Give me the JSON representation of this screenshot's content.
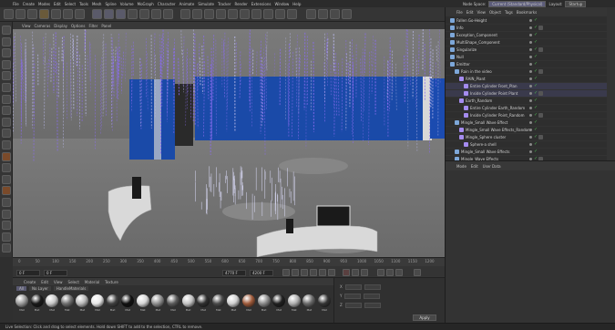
{
  "menubar": {
    "items": [
      "File",
      "Create",
      "Modes",
      "Edit",
      "Select",
      "Tools",
      "Mesh",
      "Spline",
      "Volume",
      "MoGraph",
      "Character",
      "Animate",
      "Simulate",
      "Tracker",
      "Render",
      "Extensions",
      "Window",
      "Help"
    ]
  },
  "topright": {
    "node_space_label": "Node Space:",
    "node_space_value": "Current (Standard/Physical)",
    "layout_label": "Layout:",
    "layout_value": "Startup"
  },
  "viewport_menu": [
    "View",
    "Cameras",
    "Display",
    "Options",
    "Filter",
    "Panel"
  ],
  "object_manager": {
    "menu": [
      "File",
      "Edit",
      "View",
      "Object",
      "Tags",
      "Bookmarks"
    ],
    "objects": [
      {
        "name": "Fallen Go-Height",
        "indent": 0
      },
      {
        "name": "Info",
        "indent": 0
      },
      {
        "name": "Exception_Component",
        "indent": 0
      },
      {
        "name": "MultiShape_Component",
        "indent": 0
      },
      {
        "name": "Singularize",
        "indent": 0
      },
      {
        "name": "Null",
        "indent": 0
      },
      {
        "name": "Emitter",
        "indent": 0
      },
      {
        "name": "Rain in the video",
        "indent": 1
      },
      {
        "name": "RAIN_Plant",
        "indent": 2
      },
      {
        "name": "Entire Cylinder Front_Plan",
        "indent": 3
      },
      {
        "name": "Inside Cylinder Point Plant",
        "indent": 3
      },
      {
        "name": "Earth_Random",
        "indent": 2
      },
      {
        "name": "Entire Cylinder Earth_Random",
        "indent": 3
      },
      {
        "name": "Inside Cylinder Point_Random",
        "indent": 3
      },
      {
        "name": "Mingle_Small Wave Effect",
        "indent": 1
      },
      {
        "name": "Mingle_Small Wave Effects_Random",
        "indent": 2
      },
      {
        "name": "Mingle_Sphere cluster",
        "indent": 2
      },
      {
        "name": "Sphere-a shell",
        "indent": 3
      },
      {
        "name": "Mingle_Small Wave Effects",
        "indent": 1
      },
      {
        "name": "Mingle_Wave Effects",
        "indent": 1
      }
    ]
  },
  "attribute_manager": {
    "menu": [
      "Mode",
      "Edit",
      "User Data"
    ]
  },
  "timeline": {
    "ticks": [
      "0",
      "50",
      "100",
      "150",
      "200",
      "250",
      "300",
      "350",
      "400",
      "450",
      "500",
      "550",
      "600",
      "650",
      "700",
      "750",
      "800",
      "850",
      "900",
      "950",
      "1000",
      "1050",
      "1100",
      "1150",
      "1200"
    ],
    "current_frame": "0 F",
    "start_frame": "0 F",
    "end_frame": "4770 F",
    "max_frame": "4200 F"
  },
  "material_panel": {
    "tabs": [
      "Create",
      "Edit",
      "View",
      "Select",
      "Material",
      "Texture"
    ],
    "filters": [
      "All",
      "No Layer",
      "HandleMaterials"
    ],
    "materials": [
      {
        "label": "Mat",
        "color": "#9a9a9a"
      },
      {
        "label": "Mat",
        "color": "#1a1a1a"
      },
      {
        "label": "Mat",
        "color": "#c8c8c8"
      },
      {
        "label": "Mat",
        "color": "#707070"
      },
      {
        "label": "Mat",
        "color": "#b8b8b8"
      },
      {
        "label": "Mat",
        "color": "#e8e8e8"
      },
      {
        "label": "Mat",
        "color": "#404040"
      },
      {
        "label": "Mat",
        "color": "#111111"
      },
      {
        "label": "Mat",
        "color": "#d6d6d6"
      },
      {
        "label": "Mat",
        "color": "#8f8f8f"
      },
      {
        "label": "Mat",
        "color": "#5b5b5b"
      },
      {
        "label": "Mat",
        "color": "#c3c3c3"
      },
      {
        "label": "Mat",
        "color": "#303030"
      },
      {
        "label": "Mat",
        "color": "#4a4a4a"
      },
      {
        "label": "Mat",
        "color": "#cfcfcf"
      },
      {
        "label": "Mat",
        "color": "#9e5a3a"
      },
      {
        "label": "Mat",
        "color": "#8a8a8a"
      },
      {
        "label": "Mat",
        "color": "#202020"
      },
      {
        "label": "Mat",
        "color": "#b0b0b0"
      },
      {
        "label": "Mat",
        "color": "#6a6a6a"
      },
      {
        "label": "Mat",
        "color": "#353535"
      }
    ]
  },
  "attributes": {
    "rows": [
      {
        "label": "X",
        "value": "0 cm"
      },
      {
        "label": "Y",
        "value": "0 cm"
      },
      {
        "label": "Z",
        "value": "0 cm"
      }
    ],
    "apply_label": "Apply"
  },
  "status": {
    "text": "Live Selection: Click and drag to select elements. Hold down SHIFT to add to the selection, CTRL to remove."
  },
  "colors": {
    "rain": "#8a6cf0",
    "blue_wall": "#1a4aa8",
    "floor": "#7a7a7a"
  }
}
